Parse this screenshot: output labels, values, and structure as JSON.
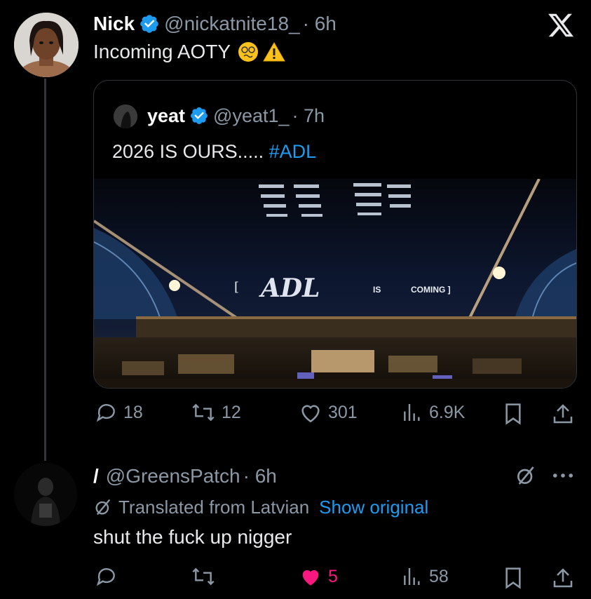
{
  "app": {
    "x_logo": "x-logo-icon"
  },
  "tweet": {
    "name": "Nick",
    "handle": "@nickatnite18_",
    "time": "· 6h",
    "text": "Incoming AOTY",
    "emojis": [
      "😵‍💫",
      "⚠️"
    ]
  },
  "quote": {
    "name": "yeat",
    "handle": "@yeat1_",
    "time": "· 7h",
    "text": "2026 IS OURS.....",
    "hashtag": "#ADL",
    "image": {
      "banner_left": "[",
      "logo_text": "ADL",
      "is_text": "IS",
      "coming_text": "COMING ]"
    }
  },
  "tweet_actions": {
    "replies": "18",
    "reposts": "12",
    "likes": "301",
    "views": "6.9K"
  },
  "reply": {
    "name": "/",
    "handle": "@GreensPatch",
    "time": "· 6h",
    "translated": "Translated from Latvian",
    "show_original": "Show original",
    "text": "shut the fuck up nigger",
    "actions": {
      "replies": "",
      "reposts": "",
      "likes": "5",
      "views": "58"
    }
  },
  "colors": {
    "background": "#000000",
    "link": "#1d9bf0",
    "verified": "#1d9bf0",
    "like_active": "#f91880",
    "muted": "#8b98a5"
  }
}
